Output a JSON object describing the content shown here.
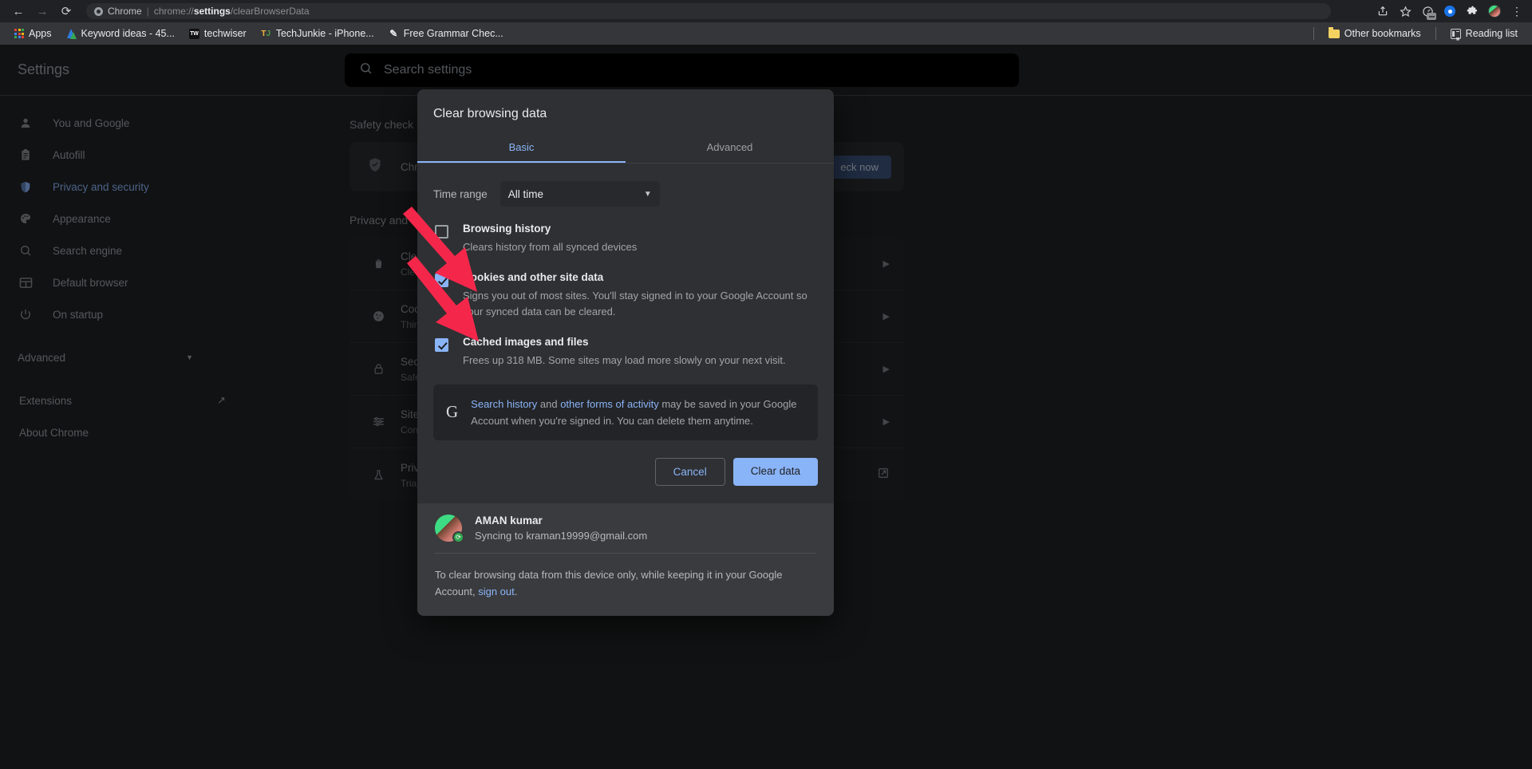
{
  "browser": {
    "nav": {
      "back": "←",
      "forward": "→",
      "reload": "⟳"
    },
    "omnibox": {
      "site_label": "Chrome",
      "separator": "|",
      "url_prefix": "chrome://",
      "url_bold": "settings",
      "url_suffix": "/clearBrowserData"
    },
    "toolbar_icons": [
      {
        "name": "share-icon",
        "glyph": "⬆"
      },
      {
        "name": "bookmark-star-icon",
        "glyph": "☆"
      },
      {
        "name": "speedometer-icon",
        "glyph": "◴"
      },
      {
        "name": "blue-circle-icon",
        "glyph": ""
      },
      {
        "name": "extensions-puzzle-icon",
        "glyph": "🧩"
      },
      {
        "name": "profile-avatar",
        "glyph": ""
      },
      {
        "name": "chrome-menu-icon",
        "glyph": "⋮"
      }
    ]
  },
  "bookmarks": {
    "apps_label": "Apps",
    "items": [
      {
        "label": "Keyword ideas - 45...",
        "icon": "keyword-planner-icon"
      },
      {
        "label": "techwiser",
        "icon": "techwiser-icon"
      },
      {
        "label": "TechJunkie - iPhone...",
        "icon": "techjunkie-icon"
      },
      {
        "label": "Free Grammar Chec...",
        "icon": "grammarly-icon"
      }
    ],
    "other_bookmarks": "Other bookmarks",
    "reading_list": "Reading list"
  },
  "settings": {
    "title": "Settings",
    "search_placeholder": "Search settings",
    "sidebar": [
      {
        "label": "You and Google",
        "icon": "person-icon",
        "active": false
      },
      {
        "label": "Autofill",
        "icon": "clipboard-icon",
        "active": false
      },
      {
        "label": "Privacy and security",
        "icon": "shield-icon",
        "active": true
      },
      {
        "label": "Appearance",
        "icon": "palette-icon",
        "active": false
      },
      {
        "label": "Search engine",
        "icon": "magnifier-icon",
        "active": false
      },
      {
        "label": "Default browser",
        "icon": "window-icon",
        "active": false
      },
      {
        "label": "On startup",
        "icon": "power-icon",
        "active": false
      }
    ],
    "advanced_label": "Advanced",
    "extensions_label": "Extensions",
    "about_label": "About Chrome",
    "safety_check": {
      "heading": "Safety check",
      "text": "Chro",
      "button": "eck now"
    },
    "privacy": {
      "heading": "Privacy and s",
      "rows": [
        {
          "title": "Clear",
          "sub": "Clear",
          "icon": "trash-icon",
          "arrow": "▶"
        },
        {
          "title": "Coo",
          "sub": "Third",
          "icon": "cookie-icon",
          "arrow": "▶"
        },
        {
          "title": "Secu",
          "sub": "Safe",
          "icon": "lock-icon",
          "arrow": "▶"
        },
        {
          "title": "Site S",
          "sub": "Cont",
          "icon": "sliders-icon",
          "arrow": "▶"
        },
        {
          "title": "Priva",
          "sub": "Trial",
          "icon": "flask-icon",
          "arrow": "↗"
        }
      ]
    }
  },
  "dialog": {
    "title": "Clear browsing data",
    "tabs": [
      {
        "label": "Basic",
        "active": true
      },
      {
        "label": "Advanced",
        "active": false
      }
    ],
    "time_range": {
      "label": "Time range",
      "value": "All time",
      "caret": "▼"
    },
    "options": [
      {
        "title": "Browsing history",
        "sub": "Clears history from all synced devices",
        "checked": false
      },
      {
        "title": "Cookies and other site data",
        "sub": "Signs you out of most sites. You'll stay signed in to your Google Account so your synced data can be cleared.",
        "checked": true
      },
      {
        "title": "Cached images and files",
        "sub": "Frees up 318 MB. Some sites may load more slowly on your next visit.",
        "checked": true
      }
    ],
    "google_note": {
      "link1": "Search history",
      "mid": " and ",
      "link2": "other forms of activity",
      "tail": " may be saved in your Google Account when you're signed in. You can delete them anytime."
    },
    "buttons": {
      "cancel": "Cancel",
      "confirm": "Clear data"
    },
    "account": {
      "name": "AMAN kumar",
      "sync_text": "Syncing to kraman19999@gmail.com"
    },
    "footer": {
      "text_before": "To clear browsing data from this device only, while keeping it in your Google Account, ",
      "link": "sign out",
      "text_after": "."
    }
  },
  "colors": {
    "accent_blue": "#8ab4f8",
    "arrow_red": "#f4274b",
    "dialog_bg": "#2f3033",
    "page_bg": "#202124"
  }
}
